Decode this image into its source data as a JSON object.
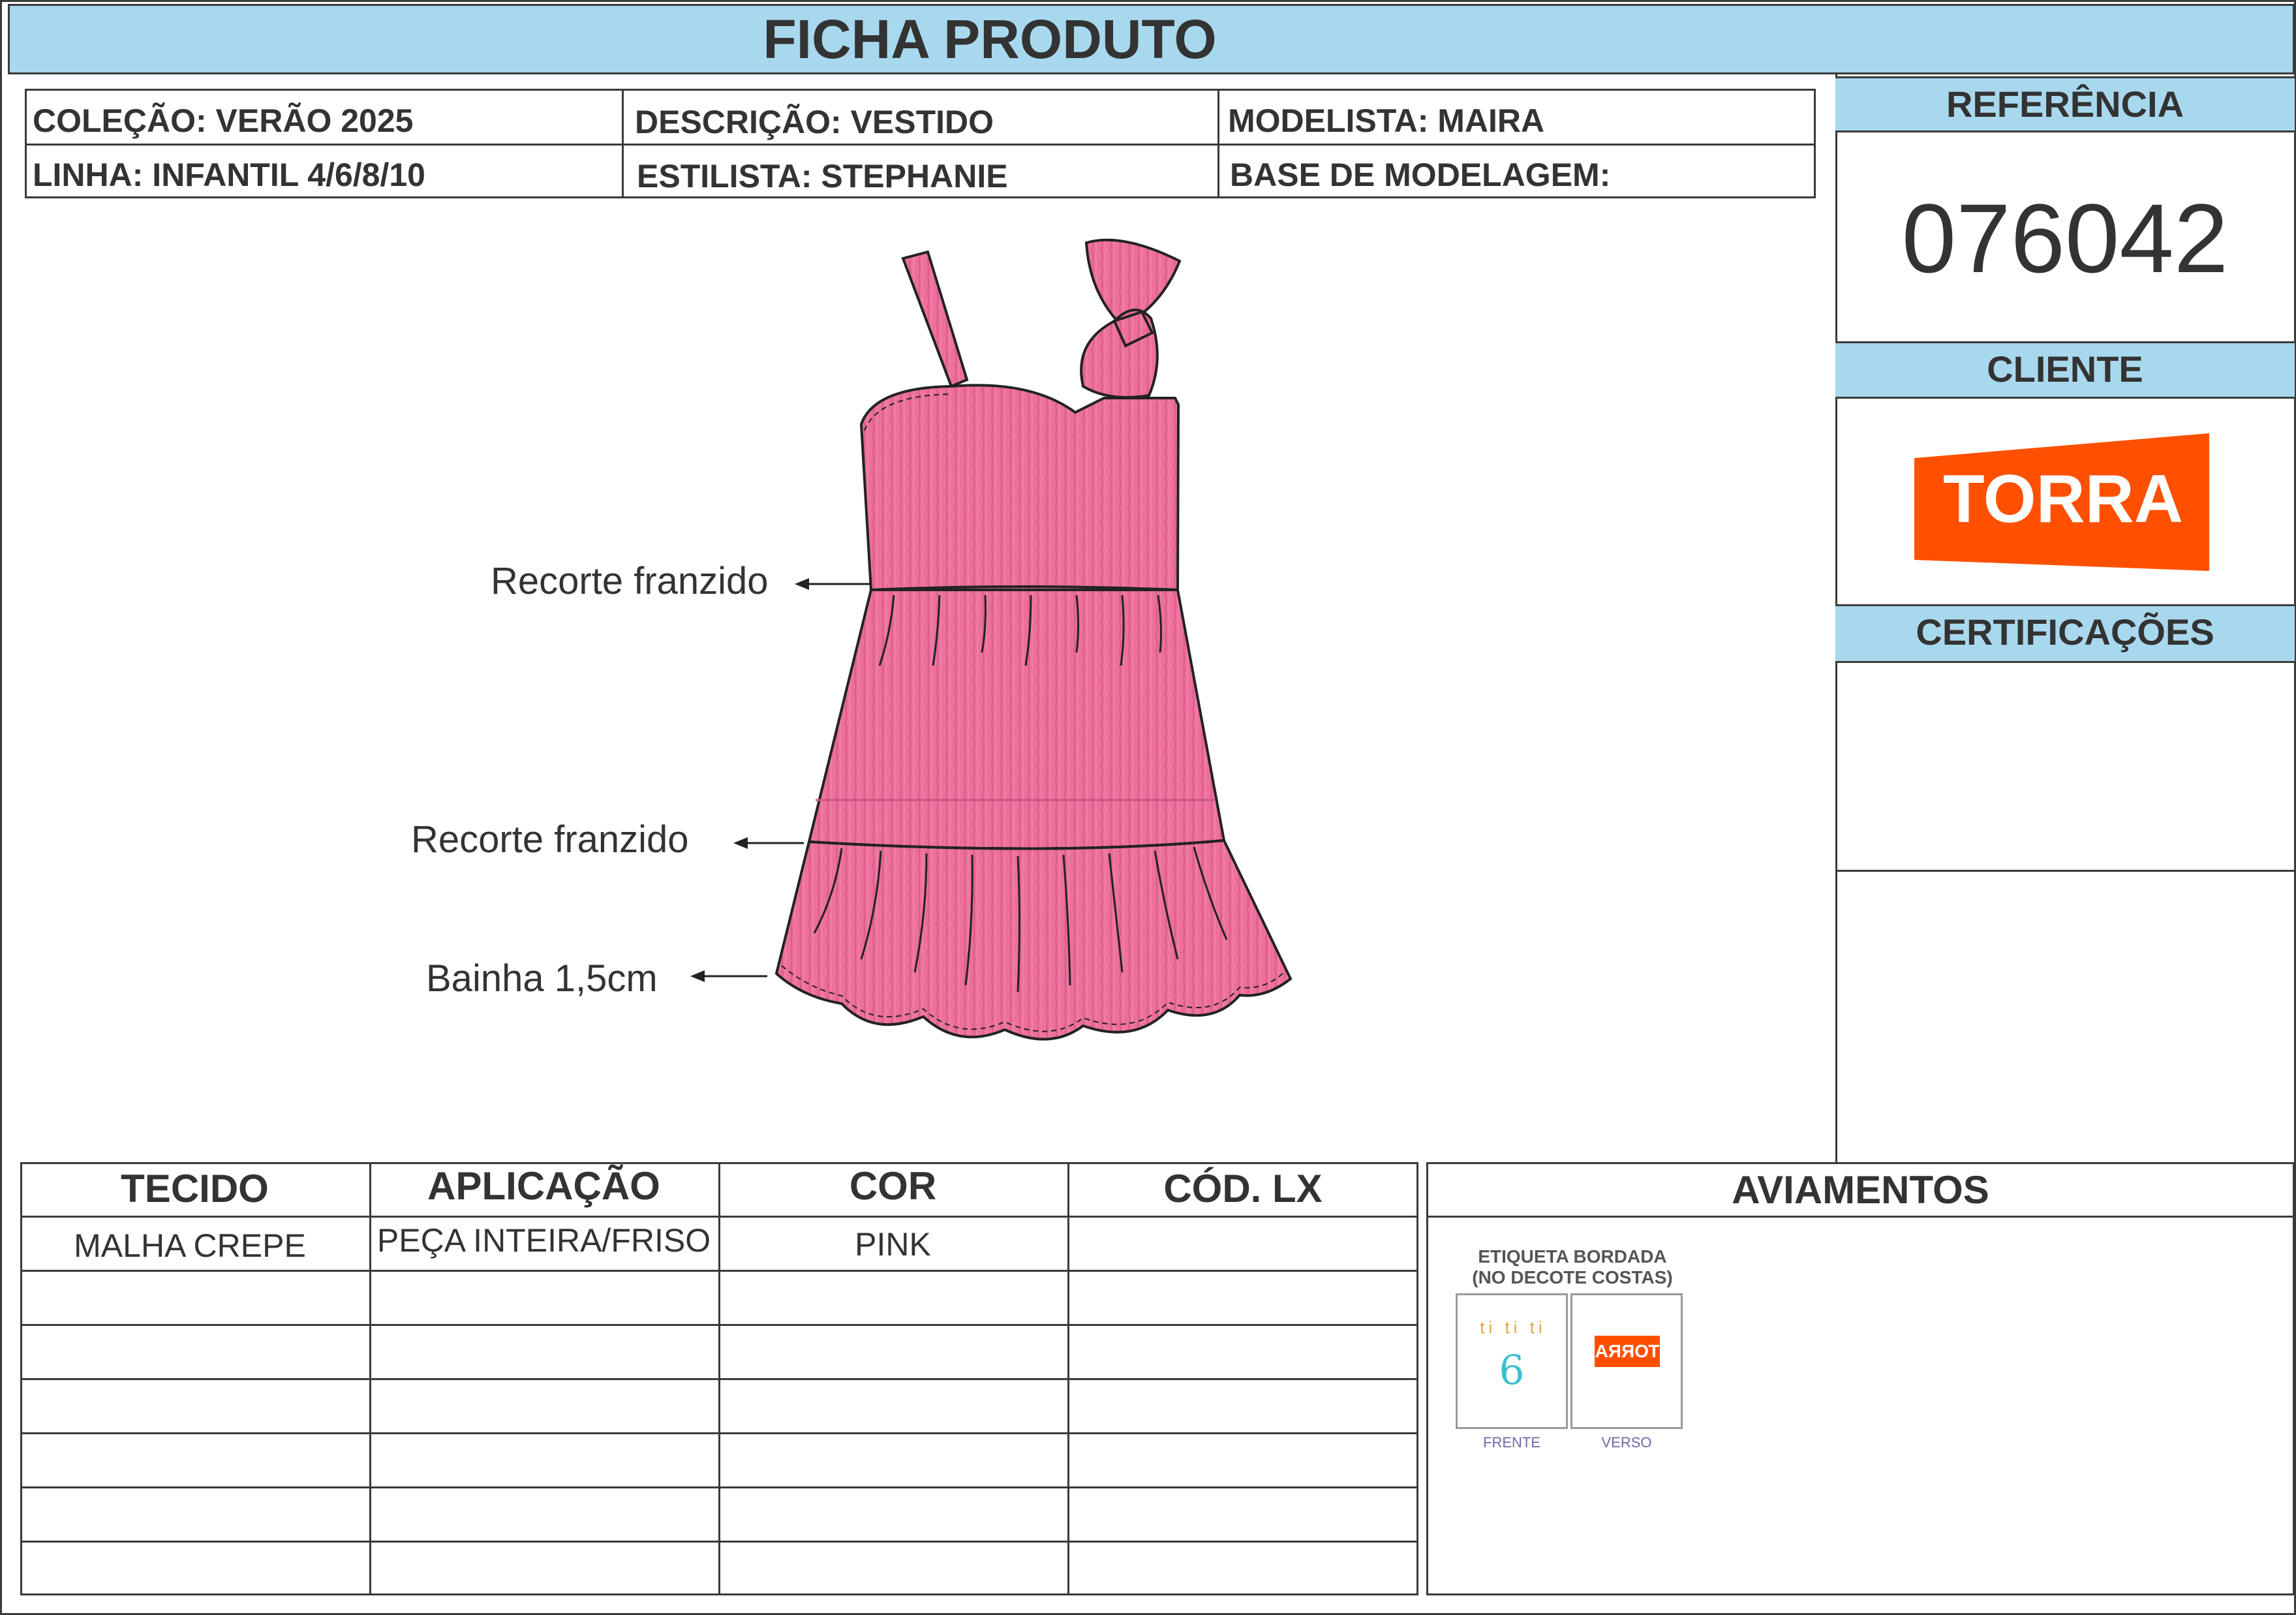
{
  "title": "FICHA PRODUTO",
  "header": {
    "colecao": "COLEÇÃO: VERÃO 2025",
    "descricao": "DESCRIÇÃO: VESTIDO",
    "modelista": "MODELISTA: MAIRA",
    "linha": "LINHA: INFANTIL 4/6/8/10",
    "estilista": "ESTILISTA: STEPHANIE",
    "base": "BASE DE MODELAGEM:"
  },
  "sidebar": {
    "referencia_label": "REFERÊNCIA",
    "referencia_value": "076042",
    "cliente_label": "CLIENTE",
    "cliente_logo": "TORRA",
    "certificacoes_label": "CERTIFICAÇÕES"
  },
  "callouts": {
    "recorte_1": "Recorte franzido",
    "recorte_2": "Recorte franzido",
    "bainha": "Bainha 1,5cm"
  },
  "materials": {
    "headers": [
      "TECIDO",
      "APLICAÇÃO",
      "COR",
      "CÓD. LX"
    ],
    "rows": [
      [
        "MALHA CREPE",
        "PEÇA INTEIRA/FRISO",
        "PINK",
        ""
      ]
    ]
  },
  "aviamentos": {
    "title": "AVIAMENTOS",
    "label_line1": "ETIQUETA BORDADA",
    "label_line2": "(NO DECOTE COSTAS)",
    "front_caption": "FRENTE",
    "back_caption": "VERSO",
    "front_size": "6",
    "back_logo": "TORRA"
  },
  "colors": {
    "banner": "#a8d8ee",
    "dress": "#ec6f9c",
    "torra": "#fe5000"
  }
}
